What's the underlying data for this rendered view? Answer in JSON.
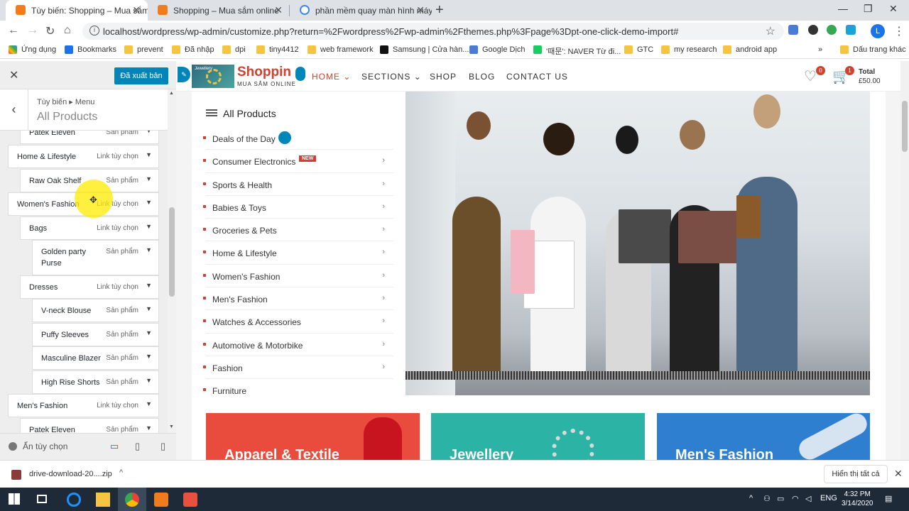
{
  "browser": {
    "tabs": [
      {
        "title": "Tùy biến: Shopping – Mua sắm o",
        "favicon_color": "#f07c1e"
      },
      {
        "title": "Shopping – Mua sắm online",
        "favicon_color": "#f07c1e"
      },
      {
        "title": "phần mềm quay màn hình máy t",
        "favicon_color": "#4285f4"
      }
    ],
    "url": "localhost/wordpress/wp-admin/customize.php?return=%2Fwordpress%2Fwp-admin%2Fthemes.php%3Fpage%3Dpt-one-click-demo-import#",
    "profile_initial": "L",
    "bookmarks": [
      "Ứng dụng",
      "Bookmarks",
      "prevent",
      "Đã nhập",
      "dpi",
      "tiny4412",
      "web framework",
      "Samsung | Cửa hàn...",
      "Google Dịch",
      "'때문': NAVER Từ đi...",
      "GTC",
      "my research",
      "android app"
    ],
    "bookmarks_more": "»",
    "other_bookmarks": "Dấu trang khác"
  },
  "customizer": {
    "publish_label": "Đã xuất bản",
    "breadcrumb": "Tùy biến ▸ Menu",
    "panel_title": "All Products",
    "items": [
      {
        "label": "Patek Eleven",
        "type": "Sản phẩm"
      },
      {
        "label": "Home & Lifestyle",
        "type": "Link tùy chọn"
      },
      {
        "label": "Raw Oak Shelf",
        "type": "Sản phẩm"
      },
      {
        "label": "Women's Fashion",
        "type": "Link tùy chọn"
      },
      {
        "label": "Bags",
        "type": "Link tùy chọn"
      },
      {
        "label": "Golden party Purse",
        "type": "Sản phẩm"
      },
      {
        "label": "Dresses",
        "type": "Link tùy chọn"
      },
      {
        "label": "V-neck Blouse",
        "type": "Sản phẩm"
      },
      {
        "label": "Puffy Sleeves",
        "type": "Sản phẩm"
      },
      {
        "label": "Masculine Blazer",
        "type": "Sản phẩm"
      },
      {
        "label": "High Rise Shorts",
        "type": "Sản phẩm"
      },
      {
        "label": "Men's Fashion",
        "type": "Link tùy chọn"
      },
      {
        "label": "Patek Eleven",
        "type": "Sản phẩm"
      }
    ],
    "hide_controls_label": "Ẩn tùy chọn"
  },
  "site": {
    "brand": "Shoppin",
    "tagline": "MUA SẮM ONLINE",
    "logo_text": "Jewellery",
    "nav": {
      "home": "HOME",
      "sections": "SECTIONS",
      "shop": "SHOP",
      "blog": "BLOG",
      "contact": "CONTACT US"
    },
    "wishlist_count": "0",
    "cart_count": "1",
    "cart_total_label": "Total",
    "cart_total": "£50.00",
    "categories_title": "All Products",
    "categories": [
      "Deals of the Day",
      "Consumer Electronics",
      "Sports & Health",
      "Babies & Toys",
      "Groceries & Pets",
      "Home & Lifestyle",
      "Women's Fashion",
      "Men's Fashion",
      "Watches & Accessories",
      "Automotive & Motorbike",
      "Fashion",
      "Furniture"
    ],
    "new_badge": "NEW",
    "promos": [
      {
        "title": "Apparel & Textile",
        "color": "#e94b3c"
      },
      {
        "title": "Jewellery",
        "color": "#2bb3a6"
      },
      {
        "title": "Men's Fashion",
        "color": "#2f7fd0"
      }
    ]
  },
  "downloads": {
    "file": "drive-download-20....zip",
    "show_all": "Hiển thị tất cả"
  },
  "taskbar": {
    "lang": "ENG",
    "time": "4:32 PM",
    "date": "3/14/2020"
  },
  "colors": {
    "accent": "#d0412f",
    "wp_blue": "#0085ba"
  }
}
